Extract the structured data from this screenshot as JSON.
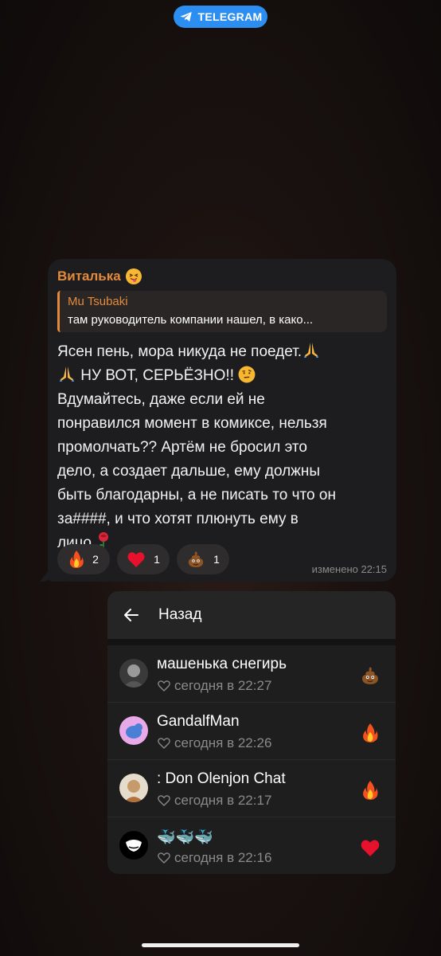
{
  "source_badge": {
    "label": "TELEGRAM",
    "icon": "telegram-plane-icon",
    "color": "#2b8ef0"
  },
  "message": {
    "sender": "Виталька",
    "sender_emoji": "squinting-tongue-face",
    "sender_color": "#e48a3a",
    "reply": {
      "name": "Mu Tsubaki",
      "text": "там руководитель компании нашел, в како..."
    },
    "text_lines": [
      "Ясен пень, мора никуда не поедет.",
      " НУ ВОТ, СЕРЬЁЗНО!! ",
      "Вдумайтесь, даже если ей не",
      "понравился момент в комиксе, нельзя",
      "промолчать?? Артём не бросил это",
      "дело, а создает дальше, ему должны",
      "быть благодарны, а не писать то что он",
      "за####, и что хотят плюнуть ему в",
      "лицо."
    ],
    "reactions": [
      {
        "emoji": "fire",
        "count": "2"
      },
      {
        "emoji": "red-heart",
        "count": "1"
      },
      {
        "emoji": "pile-of-poo",
        "count": "1"
      }
    ],
    "edited_label": "изменено 22:15"
  },
  "reactions_panel": {
    "back_label": "Назад",
    "rows": [
      {
        "name": "машенька снегирь",
        "time": "сегодня в 22:27",
        "reaction": "pile-of-poo"
      },
      {
        "name": "GandalfMan",
        "time": "сегодня в 22:26",
        "reaction": "fire"
      },
      {
        "name": ": Don Olenjon Chat",
        "time": "сегодня в 22:17",
        "reaction": "fire"
      },
      {
        "name": "🐳🐳🐳",
        "time": "сегодня в 22:16",
        "reaction": "red-heart"
      }
    ]
  }
}
